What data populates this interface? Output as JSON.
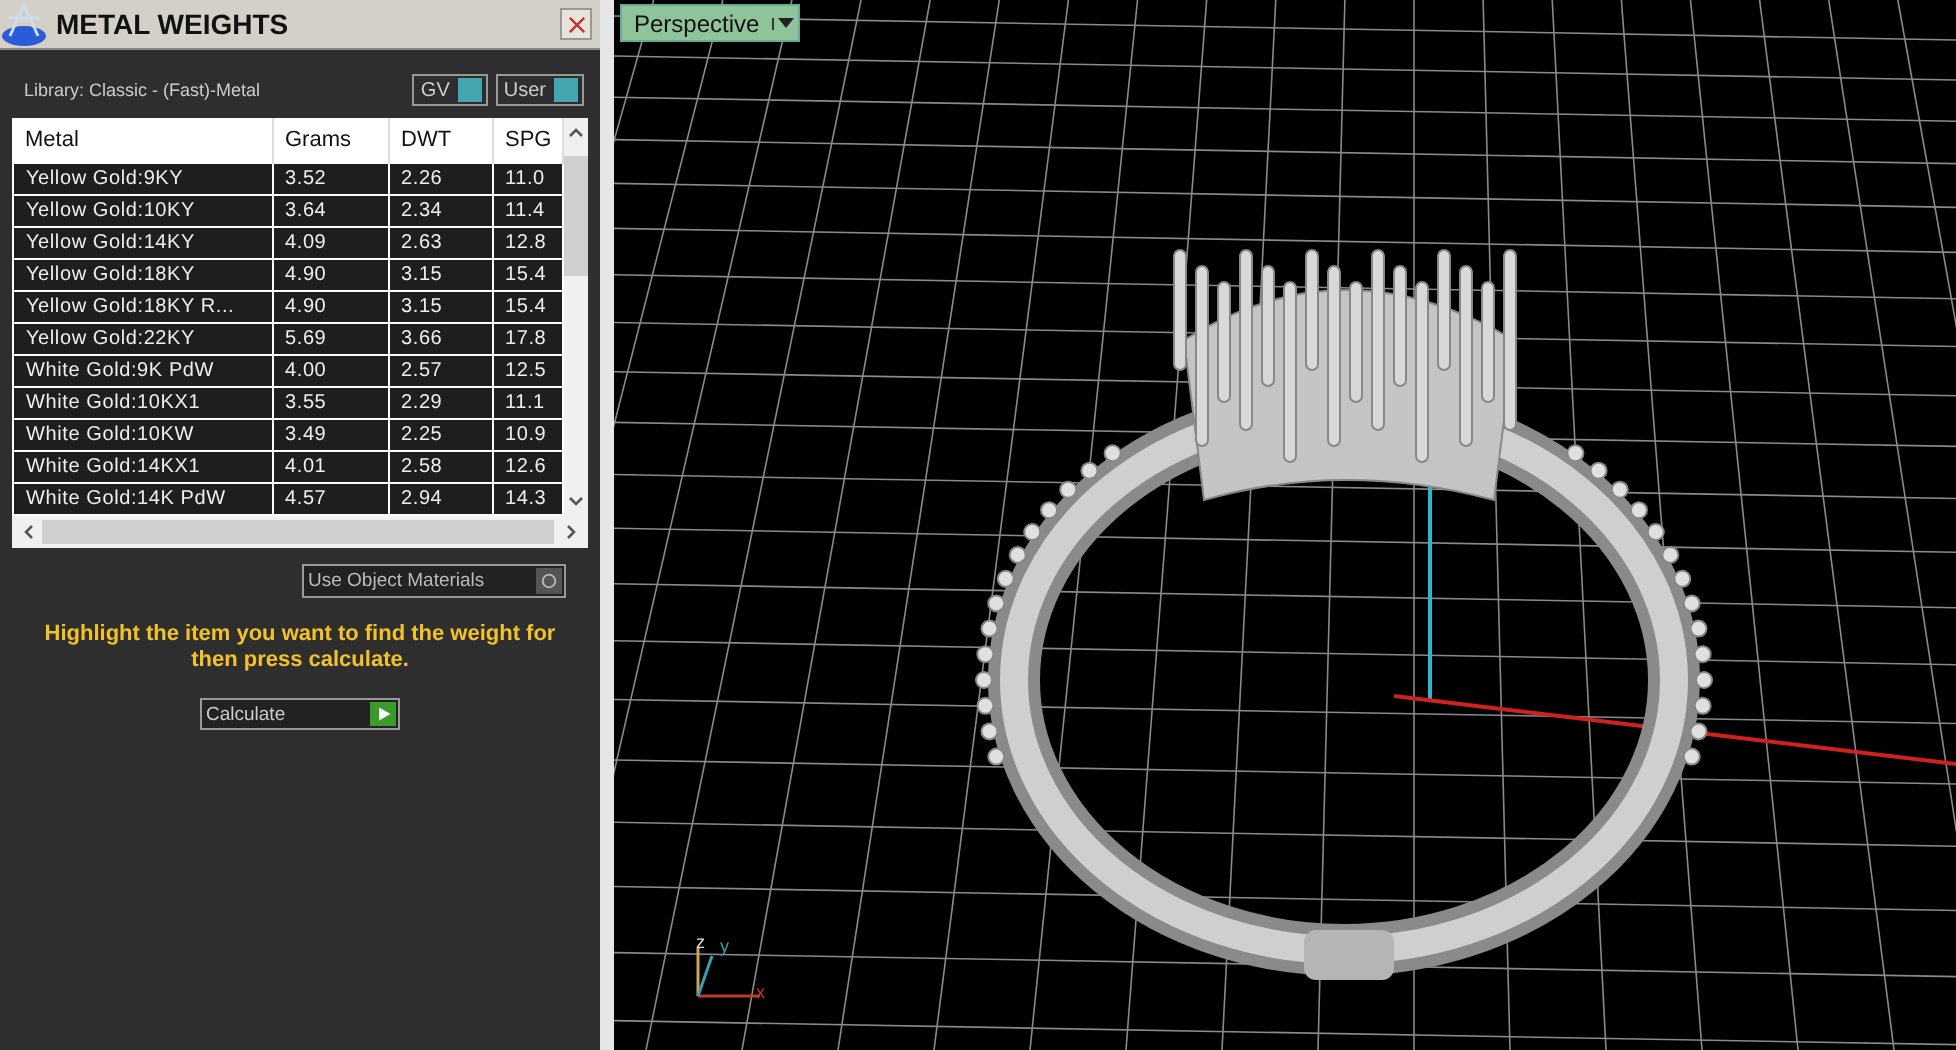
{
  "panel": {
    "title": "METAL WEIGHTS",
    "library": "Library: Classic - (Fast)-Metal",
    "toggles": [
      {
        "label": "GV",
        "on": true
      },
      {
        "label": "User",
        "on": true
      }
    ],
    "table": {
      "columns": [
        "Metal",
        "Grams",
        "DWT",
        "SPG"
      ],
      "rows": [
        [
          "Yellow Gold:9KY",
          "3.52",
          "2.26",
          "11.0"
        ],
        [
          "Yellow Gold:10KY",
          "3.64",
          "2.34",
          "11.4"
        ],
        [
          "Yellow Gold:14KY",
          "4.09",
          "2.63",
          "12.8"
        ],
        [
          "Yellow Gold:18KY",
          "4.90",
          "3.15",
          "15.4"
        ],
        [
          "Yellow Gold:18KY R...",
          "4.90",
          "3.15",
          "15.4"
        ],
        [
          "Yellow Gold:22KY",
          "5.69",
          "3.66",
          "17.8"
        ],
        [
          "White Gold:9K PdW",
          "4.00",
          "2.57",
          "12.5"
        ],
        [
          "White Gold:10KX1",
          "3.55",
          "2.29",
          "11.1"
        ],
        [
          "White Gold:10KW",
          "3.49",
          "2.25",
          "10.9"
        ],
        [
          "White Gold:14KX1",
          "4.01",
          "2.58",
          "12.6"
        ],
        [
          "White Gold:14K PdW",
          "4.57",
          "2.94",
          "14.3"
        ]
      ]
    },
    "materials": {
      "label": "Use Object Materials"
    },
    "message": "Highlight the item you want to find the weight for then press calculate.",
    "calculate": "Calculate"
  },
  "viewport": {
    "view": "Perspective",
    "axes": [
      "z",
      "y",
      "x"
    ]
  }
}
